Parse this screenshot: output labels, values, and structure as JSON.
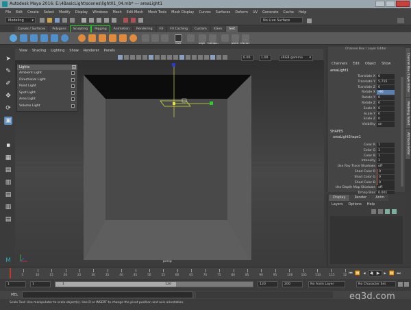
{
  "window": {
    "title": "Autodesk Maya 2016: E:\\4BasicLight\\scenes\\light01_04.mb*   ---   areaLight1"
  },
  "menubar": [
    "File",
    "Edit",
    "Create",
    "Select",
    "Modify",
    "Display",
    "Windows",
    "Mesh",
    "Edit Mesh",
    "Mesh Tools",
    "Mesh Display",
    "Curves",
    "Surfaces",
    "Deform",
    "UV",
    "Generate",
    "Cache",
    "Help"
  ],
  "statusline": {
    "menuset": "Modeling",
    "live_surface": "No Live Surface"
  },
  "shelf_tabs": [
    {
      "label": "Curves / Surfaces",
      "active": false
    },
    {
      "label": "Polygons",
      "active": false
    },
    {
      "label": "Sculpting",
      "active": false
    },
    {
      "label": "Rigging",
      "active": false
    },
    {
      "label": "Animation",
      "active": false
    },
    {
      "label": "Rendering",
      "active": false
    },
    {
      "label": "FX",
      "active": false
    },
    {
      "label": "FX Caching",
      "active": false
    },
    {
      "label": "Custom",
      "active": false
    },
    {
      "label": "XGen",
      "active": false
    },
    {
      "label": "test",
      "active": true
    }
  ],
  "shelf_icon_labels": [
    "Outl",
    "vdye",
    "Compo...",
    "pickC",
    "cfxcscr"
  ],
  "viewport": {
    "menu": [
      "View",
      "Shading",
      "Lighting",
      "Show",
      "Renderer",
      "Panels"
    ],
    "field_a": "0.00",
    "field_b": "1.00",
    "color_space": "sRGB gamma",
    "camera_label": "persp"
  },
  "lights_panel": {
    "title": "Lights",
    "items": [
      "Ambient Light",
      "Directional Light",
      "Point Light",
      "Spot Light",
      "Area Light",
      "Volume Light"
    ]
  },
  "channel_box": {
    "header": "Channel Box / Layer Editor",
    "menu": [
      "Channels",
      "Edit",
      "Object",
      "Show"
    ],
    "node": "areaLight1",
    "attributes": [
      {
        "name": "Translate X",
        "value": "0"
      },
      {
        "name": "Translate Y",
        "value": "5.715"
      },
      {
        "name": "Translate Z",
        "value": "0"
      },
      {
        "name": "Rotate X",
        "value": "-90",
        "highlight": true
      },
      {
        "name": "Rotate Y",
        "value": "0"
      },
      {
        "name": "Rotate Z",
        "value": "0"
      },
      {
        "name": "Scale X",
        "value": "0"
      },
      {
        "name": "Scale Y",
        "value": "0"
      },
      {
        "name": "Scale Z",
        "value": "0"
      },
      {
        "name": "Visibility",
        "value": "on"
      }
    ],
    "shapes_label": "SHAPES",
    "shape_node": "areaLightShape1",
    "shape_attributes": [
      {
        "name": "Color R",
        "value": "1",
        "keyed": false
      },
      {
        "name": "Color G",
        "value": "1",
        "keyed": false
      },
      {
        "name": "Color B",
        "value": "1",
        "keyed": false
      },
      {
        "name": "Intensity",
        "value": "1",
        "keyed": false
      },
      {
        "name": "Use Ray Trace Shadows",
        "value": "off",
        "keyed": false
      },
      {
        "name": "Shad Color R",
        "value": "0",
        "keyed": true
      },
      {
        "name": "Shad Color G",
        "value": "0",
        "keyed": true
      },
      {
        "name": "Shad Color B",
        "value": "0",
        "keyed": true
      },
      {
        "name": "Use Depth Map Shadows",
        "value": "off",
        "keyed": false
      },
      {
        "name": "Dmap Bias",
        "value": "0.001",
        "keyed": false
      }
    ],
    "outputs_label": "OUTPUTS"
  },
  "side_tabs": [
    "Channel Box / Layer Editor",
    "Modeling Toolkit",
    "Attribute Editor"
  ],
  "layer_editor": {
    "tabs": [
      "Display",
      "Render",
      "Anim"
    ],
    "menu": [
      "Layers",
      "Options",
      "Help"
    ]
  },
  "timeline": {
    "ticks": [
      "5",
      "10",
      "15",
      "20",
      "25",
      "30",
      "35",
      "40",
      "45",
      "50",
      "55",
      "60",
      "65",
      "70",
      "75",
      "80",
      "85",
      "90",
      "95",
      "100",
      "105",
      "110",
      "115",
      "12"
    ],
    "current_frame": "1"
  },
  "range": {
    "start": "1",
    "start_inner": "1",
    "slider_start": "1",
    "slider_end": "120",
    "end_inner": "120",
    "end": "200",
    "anim_layer": "No Anim Layer",
    "char_set": "No Character Set"
  },
  "mel": {
    "label": "MEL"
  },
  "help_line": "Scale Tool: Use manipulator to scale object(s). Use D or INSERT to change the pivot position and axis orientation.",
  "watermark": "eq3d.com"
}
